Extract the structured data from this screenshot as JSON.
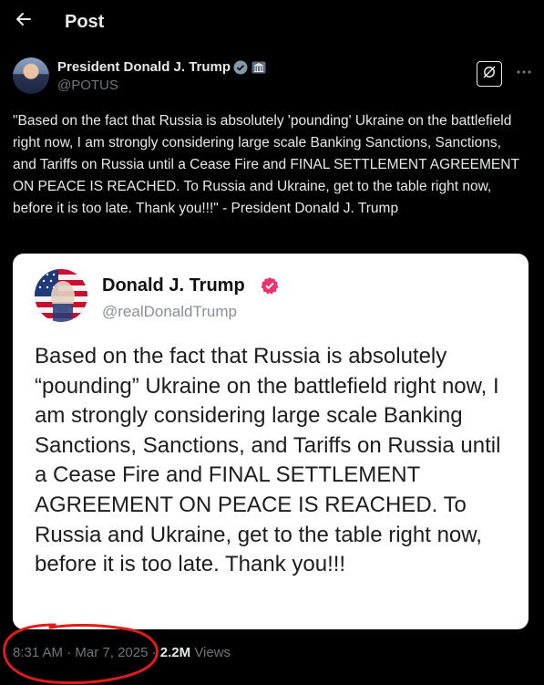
{
  "header": {
    "back_icon": "arrow-left-icon",
    "title": "Post"
  },
  "post": {
    "author_name": "President Donald J. Trump",
    "handle": "@POTUS",
    "text": "\"Based on the fact that Russia is absolutely 'pounding' Ukraine on the battlefield right now, I am strongly considering large scale Banking Sanctions, Sanctions, and Tariffs on Russia until a Cease Fire and FINAL SETTLEMENT AGREEMENT ON PEACE IS REACHED. To Russia and Ukraine, get to the table right now, before it is too late. Thank you!!!\" - President Donald J. Trump",
    "time": "8:31 AM",
    "sep1": "·",
    "date": "Mar 7, 2025",
    "sep2": "·",
    "views_count": "2.2M",
    "views_label": "Views",
    "more_icon": "more-icon",
    "grok_icon": "grok-icon",
    "verified_color": "#829aab"
  },
  "embedded": {
    "author_name": "Donald J. Trump",
    "handle": "@realDonaldTrump",
    "text": "Based on the fact that Russia is absolutely “pounding” Ukraine on the battlefield right now, I am strongly considering large scale Banking Sanctions, Sanctions, and Tariffs on Russia until a Cease Fire and FINAL SETTLEMENT AGREEMENT ON PEACE IS REACHED. To Russia and Ukraine, get to the table right now, before it is too late. Thank you!!!",
    "verified_color": "#e8346f"
  },
  "annotation": {
    "color": "#e01b1b"
  }
}
